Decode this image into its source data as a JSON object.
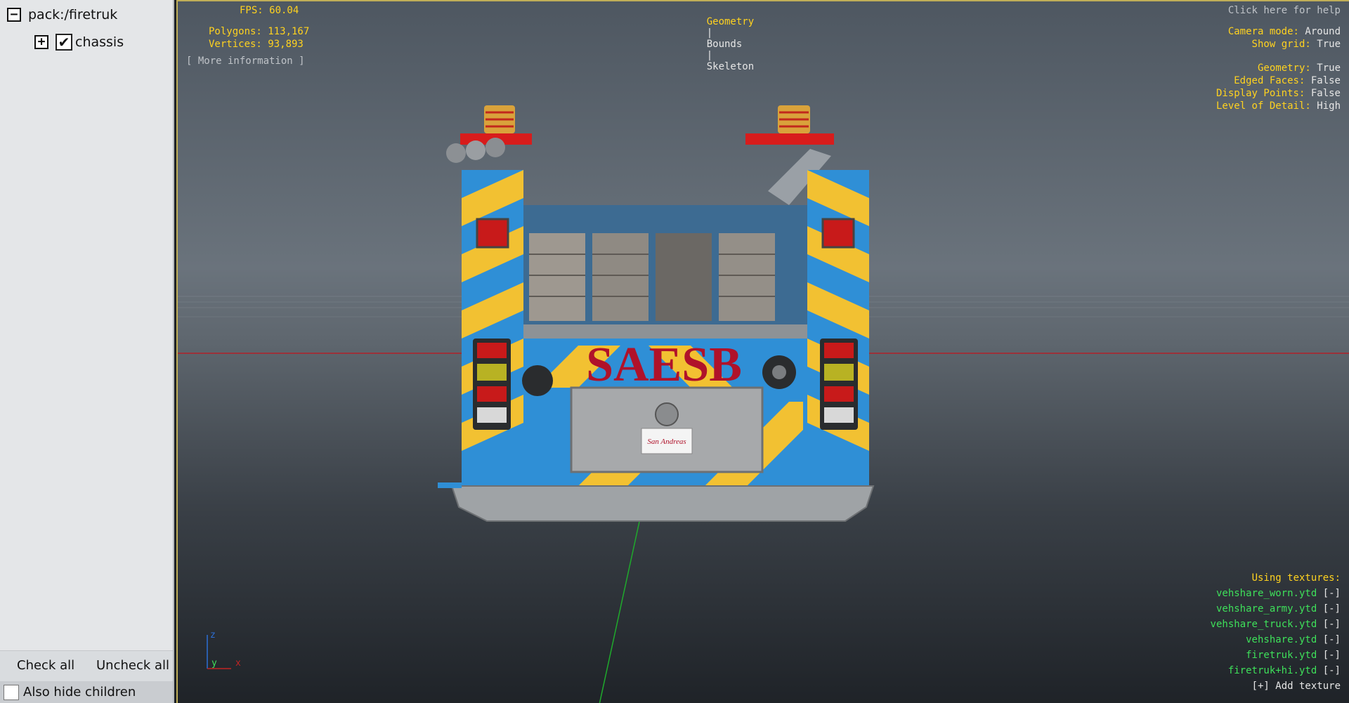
{
  "tree": {
    "root_label": "pack:/firetruk",
    "root_toggle": "−",
    "child_label": "chassis",
    "child_toggle": "+",
    "child_checked": "✔"
  },
  "bottom": {
    "check_all": "Check all",
    "uncheck_all": "Uncheck all",
    "also_hide_children": "Also hide children"
  },
  "stats": {
    "fps": "FPS: 60.04",
    "polygons": "Polygons: 113,167",
    "vertices": "Vertices: 93,893",
    "more_info": "[ More information ]"
  },
  "mode_tabs": {
    "geometry": "Geometry",
    "sep1": "|",
    "bounds": "Bounds",
    "sep2": "|",
    "skeleton": "Skeleton"
  },
  "help": "Click here for help",
  "settings": [
    {
      "key": "Camera mode:",
      "value": "Around"
    },
    {
      "key": "Show grid:",
      "value": "True"
    },
    {
      "key": "Geometry:",
      "value": "True"
    },
    {
      "key": "Edged Faces:",
      "value": "False"
    },
    {
      "key": "Display Points:",
      "value": "False"
    },
    {
      "key": "Level of Detail:",
      "value": "High"
    }
  ],
  "textures": {
    "heading": "Using textures:",
    "items": [
      {
        "name": "vehshare_worn.ytd",
        "remove": "[-]"
      },
      {
        "name": "vehshare_army.ytd",
        "remove": "[-]"
      },
      {
        "name": "vehshare_truck.ytd",
        "remove": "[-]"
      },
      {
        "name": "vehshare.ytd",
        "remove": "[-]"
      },
      {
        "name": "firetruk.ytd",
        "remove": "[-]"
      },
      {
        "name": "firetruk+hi.ytd",
        "remove": "[-]"
      }
    ],
    "add": "[+] Add texture"
  },
  "axes": {
    "z": "z",
    "y": "y",
    "x": "x"
  },
  "model": {
    "logo": "SAESB",
    "plate": "San Andreas",
    "colors": {
      "body": "#2f8fd6",
      "stripe": "#f2c132",
      "logo": "#b0122a",
      "light": "#d81c1c"
    }
  }
}
